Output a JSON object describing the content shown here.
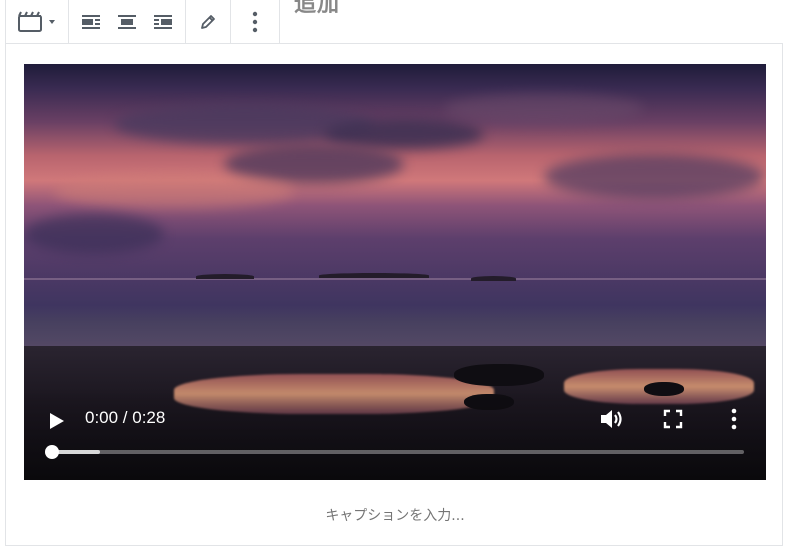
{
  "page": {
    "cutoff_heading": "追加"
  },
  "toolbar": {
    "block_type": {
      "icon": "video-icon",
      "dropdown_icon": "caret-down-icon"
    },
    "alignment": [
      "align-wide-icon",
      "align-center-icon",
      "align-full-icon"
    ],
    "edit_icon": "pencil-icon",
    "more_icon": "more-vertical-icon"
  },
  "video": {
    "time_display": "0:00 / 0:28",
    "progress": {
      "played_fraction": 0.0,
      "buffered_fraction": 0.07
    },
    "controls": {
      "play": "play-icon",
      "volume": "volume-icon",
      "fullscreen": "fullscreen-icon",
      "overflow": "more-vertical-icon"
    }
  },
  "caption": {
    "placeholder": "キャプションを入力..."
  },
  "colors": {
    "toolbar_icon": "#555d66",
    "border": "#e2e4e7",
    "caption_text": "#757575",
    "video_controls": "#ffffff"
  }
}
